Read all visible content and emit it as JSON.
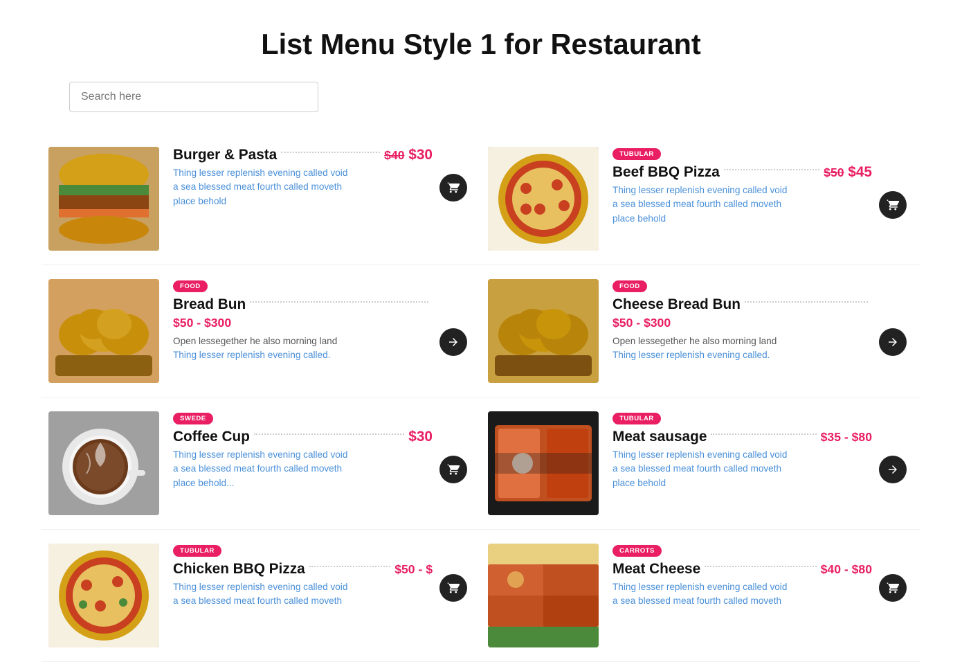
{
  "page": {
    "title": "List Menu Style 1 for Restaurant"
  },
  "search": {
    "placeholder": "Search here"
  },
  "menu_items": [
    {
      "id": "burger-pasta",
      "badge": null,
      "name": "Burger & Pasta",
      "price_original": "$40",
      "price_current": "$30",
      "price_type": "single_with_original",
      "description_line1": "Thing lesser replenish evening called void",
      "description_line2": "a sea blessed meat fourth called moveth",
      "description_line3": "place behold",
      "img_class": "img-burger",
      "cart_icon": "cart"
    },
    {
      "id": "beef-bbq-pizza",
      "badge": "TUBULAR",
      "name": "Beef BBQ Pizza",
      "price_original": "$50",
      "price_current": "$45",
      "price_type": "single_with_original",
      "description_line1": "Thing lesser replenish evening called void",
      "description_line2": "a sea blessed meat fourth called moveth",
      "description_line3": "place behold",
      "img_class": "img-pizza",
      "cart_icon": "cart"
    },
    {
      "id": "bread-bun",
      "badge": "FOOD",
      "name": "Bread Bun",
      "price_range": "$50 - $300",
      "price_type": "range",
      "description_line1": "Open lessegether he also morning land",
      "description_line2": "Thing lesser replenish evening called.",
      "img_class": "img-breadbun",
      "cart_icon": "arrow"
    },
    {
      "id": "cheese-bread-bun",
      "badge": "FOOD",
      "name": "Cheese Bread Bun",
      "price_range": "$50 - $300",
      "price_type": "range",
      "description_line1": "Open lessegether he also morning land",
      "description_line2": "Thing lesser replenish evening called.",
      "img_class": "img-cheesebread",
      "cart_icon": "arrow"
    },
    {
      "id": "coffee-cup",
      "badge": "SWEDE",
      "name": "Coffee Cup",
      "price_current": "$30",
      "price_type": "single",
      "description_line1": "Thing lesser replenish evening called void",
      "description_line2": "a sea blessed meat fourth called moveth",
      "description_line3": "place behold...",
      "img_class": "img-coffee",
      "cart_icon": "cart"
    },
    {
      "id": "meat-sausage",
      "badge": "TUBULAR",
      "name": "Meat sausage",
      "price_range": "$35 - $80",
      "price_type": "range",
      "description_line1": "Thing lesser replenish evening called void",
      "description_line2": "a sea blessed meat fourth called moveth",
      "description_line3": "place behold",
      "img_class": "img-meat",
      "cart_icon": "arrow"
    },
    {
      "id": "chicken-bbq-pizza",
      "badge": "TUBULAR",
      "name": "Chicken BBQ Pizza",
      "price_range": "$50 - $",
      "price_type": "range",
      "description_line1": "Thing lesser replenish evening called void",
      "description_line2": "a sea blessed meat fourth called moveth",
      "img_class": "img-chickenpizza",
      "cart_icon": "cart"
    },
    {
      "id": "meat-cheese",
      "badge": "CARROTS",
      "name": "Meat Cheese",
      "price_range": "$40 - $80",
      "price_type": "range",
      "description_line1": "Thing lesser replenish evening called void",
      "description_line2": "a sea blessed meat fourth called moveth",
      "img_class": "img-meatcheese",
      "cart_icon": "cart"
    }
  ]
}
